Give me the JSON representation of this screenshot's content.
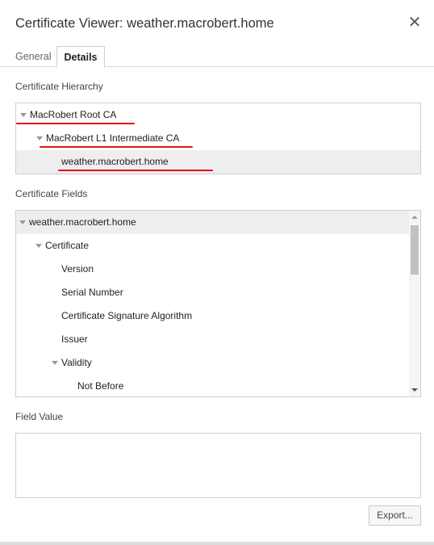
{
  "dialog": {
    "title": "Certificate Viewer: weather.macrobert.home",
    "close_glyph": "✕"
  },
  "tabs": [
    {
      "label": "General",
      "selected": false
    },
    {
      "label": "Details",
      "selected": true
    }
  ],
  "hierarchy": {
    "label": "Certificate Hierarchy",
    "items": [
      {
        "label": "MacRobert Root CA",
        "level": 0,
        "expanded": true,
        "selected": false
      },
      {
        "label": "MacRobert L1 Intermediate CA",
        "level": 1,
        "expanded": true,
        "selected": false
      },
      {
        "label": "weather.macrobert.home",
        "level": 2,
        "selected": true
      }
    ],
    "annotation_color": "#e0141a"
  },
  "fields": {
    "label": "Certificate Fields",
    "items": [
      {
        "label": "weather.macrobert.home",
        "level": 0,
        "expanded": true,
        "selected": true
      },
      {
        "label": "Certificate",
        "level": 1,
        "expanded": true
      },
      {
        "label": "Version",
        "level": 2
      },
      {
        "label": "Serial Number",
        "level": 2
      },
      {
        "label": "Certificate Signature Algorithm",
        "level": 2
      },
      {
        "label": "Issuer",
        "level": 2
      },
      {
        "label": "Validity",
        "level": 2,
        "expanded": true
      },
      {
        "label": "Not Before",
        "level": 3
      }
    ]
  },
  "field_value": {
    "label": "Field Value",
    "text": ""
  },
  "buttons": {
    "export_label": "Export..."
  }
}
